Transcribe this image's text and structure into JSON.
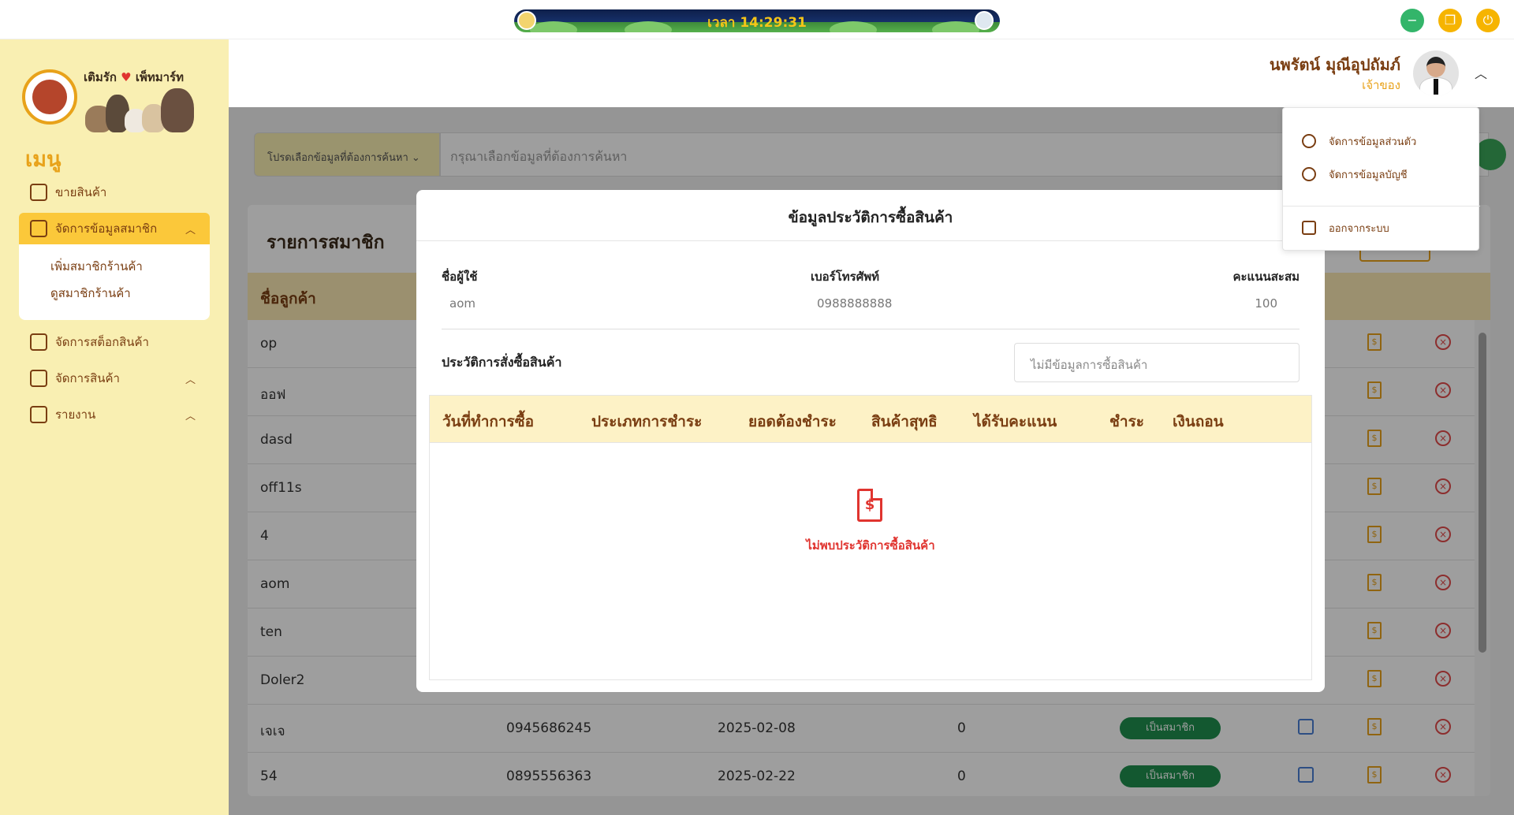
{
  "topbar": {
    "clock": "เวลา 14:29:31",
    "colors": {
      "minimize": "#33b56a",
      "restore": "#f6b400",
      "power": "#f6b400"
    }
  },
  "sidebar": {
    "brand": {
      "left": "เติมรัก",
      "right": "เพ็ทมาร์ท"
    },
    "menu_title": "เมนู",
    "items": [
      {
        "label": "ขายสินค้า",
        "icon": "cart-icon"
      },
      {
        "label": "จัดการข้อมูลสมาชิก",
        "icon": "user-plus-icon"
      },
      {
        "label": "จัดการสต็อกสินค้า",
        "icon": "store-icon"
      },
      {
        "label": "จัดการสินค้า",
        "icon": "box-icon"
      },
      {
        "label": "รายงาน",
        "icon": "report-icon"
      }
    ],
    "submenu": [
      "เพิ่มสมาชิกร้านค้า",
      "ดูสมาชิกร้านค้า"
    ]
  },
  "header": {
    "user_name": "นพรัตน์ มุณีอุปถัมภ์",
    "user_role": "เจ้าของ"
  },
  "search": {
    "select_label": "โปรดเลือกข้อมูลที่ต้องการค้นหา",
    "placeholder": "กรุณาเลือกข้อมูลที่ต้องการค้นหา"
  },
  "members": {
    "title": "รายการสมาชิก",
    "column_name": "ชื่อลูกค้า",
    "badge_label": "เป็นสมาชิก",
    "rows": [
      {
        "name": "op"
      },
      {
        "name": "ออฟ"
      },
      {
        "name": "dasd"
      },
      {
        "name": "off11s"
      },
      {
        "name": "4"
      },
      {
        "name": "aom"
      },
      {
        "name": "ten"
      },
      {
        "name": "Doler2"
      },
      {
        "name": "เจเจ",
        "phone": "0945686245",
        "date": "2025-02-08",
        "points": "0",
        "badge": "เป็นสมาชิก"
      },
      {
        "name": "54",
        "phone": "0895556363",
        "date": "2025-02-22",
        "points": "0",
        "badge": "เป็นสมาชิก"
      }
    ]
  },
  "modal": {
    "title": "ข้อมูลประวัติการซื้อสินค้า",
    "fields": {
      "username_label": "ชื่อผู้ใช้",
      "username_value": "aom",
      "phone_label": "เบอร์โทรศัพท์",
      "phone_value": "0988888888",
      "points_label": "คะแนนสะสม",
      "points_value": "100"
    },
    "history_label": "ประวัติการสั่งซื้อสินค้า",
    "history_select": "ไม่มีข้อมูลการซื้อสินค้า",
    "columns": [
      "วันที่ทำการซื้อ",
      "ประเภทการชำระ",
      "ยอดต้องชำระ",
      "สินค้าสุทธิ",
      "ได้รับคะแนน",
      "ชำระ",
      "เงินถอน"
    ],
    "empty_text": "ไม่พบประวัติการซื้อสินค้า"
  },
  "user_menu": {
    "items": [
      "จัดการข้อมูลส่วนตัว",
      "จัดการข้อมูลบัญชี"
    ],
    "logout": "ออกจากระบบ"
  }
}
